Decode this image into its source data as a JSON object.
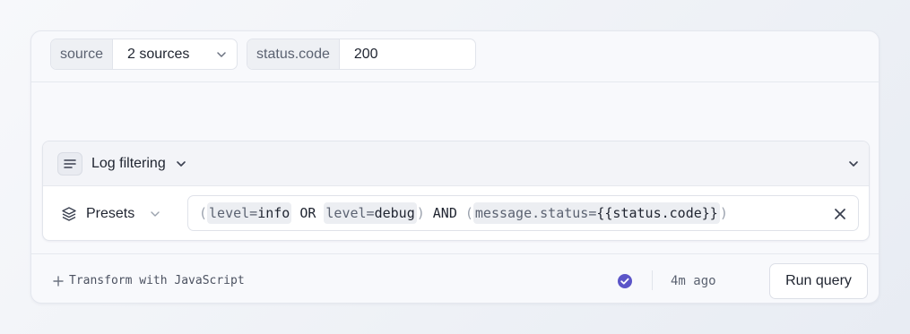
{
  "variables": [
    {
      "label": "source",
      "value": "2 sources",
      "type": "select"
    },
    {
      "label": "status.code",
      "value": "200",
      "type": "text"
    }
  ],
  "panel": {
    "title": "Log filtering",
    "presets_label": "Presets",
    "query": {
      "t1_key": "level=",
      "t1_val": "info",
      "op1": "OR",
      "t2_key": "level=",
      "t2_val": "debug",
      "op2": "AND",
      "t3_key": "message.status=",
      "t3_val": "{{status.code}}",
      "open_paren": "(",
      "close_paren": ")"
    }
  },
  "footer": {
    "transform_label": "Transform with JavaScript",
    "time_ago": "4m ago",
    "run_label": "Run query",
    "status_icon": "check-circle-icon"
  },
  "colors": {
    "accent": "#5b55c8",
    "background": "#f8f9fc"
  }
}
